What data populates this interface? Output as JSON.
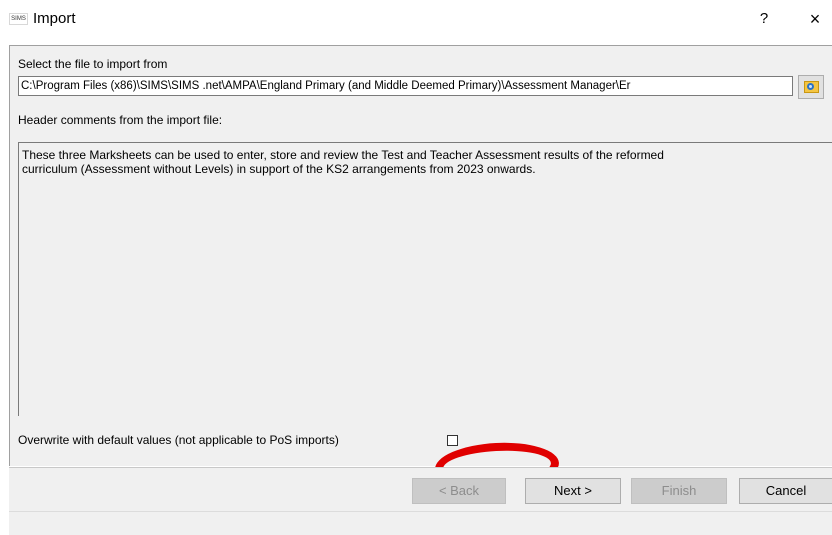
{
  "window": {
    "logo_text": "SIMS",
    "title": "Import",
    "help_label": "?",
    "close_label": "×"
  },
  "import": {
    "select_file_label": "Select the file to import from",
    "file_path": "C:\\Program Files (x86)\\SIMS\\SIMS .net\\AMPA\\England Primary (and Middle Deemed Primary)\\Assessment Manager\\Er",
    "header_comments_label": "Header comments from the import file:",
    "header_comments": "These three Marksheets can be used to enter, store and review the Test and Teacher Assessment results of the reformed\ncurriculum (Assessment without Levels) in support of the KS2 arrangements from 2023 onwards.",
    "overwrite_label": "Overwrite with default values (not applicable to PoS imports)",
    "overwrite_checked": false
  },
  "buttons": {
    "back": "< Back",
    "next": "Next >",
    "finish": "Finish",
    "cancel": "Cancel"
  },
  "colors": {
    "annotation": "#e00000",
    "panel": "#f0f0f0"
  },
  "icons": {
    "browse": "folder-search-icon"
  }
}
